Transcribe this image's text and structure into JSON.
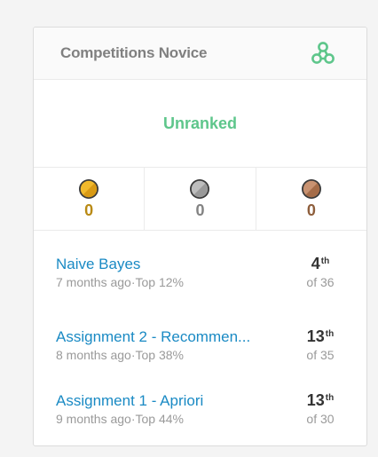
{
  "card": {
    "title": "Competitions Novice",
    "tier_icon": "network-tier-icon",
    "rank_label": "Unranked"
  },
  "medals": [
    {
      "type": "gold",
      "icon": "gold-medal-icon",
      "count": "0",
      "color": "#f1b92c",
      "text_color": "#b98a14"
    },
    {
      "type": "silver",
      "icon": "silver-medal-icon",
      "count": "0",
      "color": "#a8a8a8",
      "text_color": "#838383"
    },
    {
      "type": "bronze",
      "icon": "bronze-medal-icon",
      "count": "0",
      "color": "#c08561",
      "text_color": "#8e5e3c"
    }
  ],
  "competitions": [
    {
      "name": "Naive Bayes",
      "when": "7 months ago",
      "sep": "·",
      "top": "Top 12%",
      "rank": "4",
      "suffix": "th",
      "of": "of 36"
    },
    {
      "name": "Assignment 2 - Recommen...",
      "when": "8 months ago",
      "sep": "·",
      "top": "Top 38%",
      "rank": "13",
      "suffix": "th",
      "of": "of 35"
    },
    {
      "name": "Assignment 1 - Apriori",
      "when": "9 months ago",
      "sep": "·",
      "top": "Top 44%",
      "rank": "13",
      "suffix": "th",
      "of": "of 30"
    }
  ],
  "colors": {
    "accent_green": "#5ec68b",
    "link_blue": "#1a8ac4"
  }
}
